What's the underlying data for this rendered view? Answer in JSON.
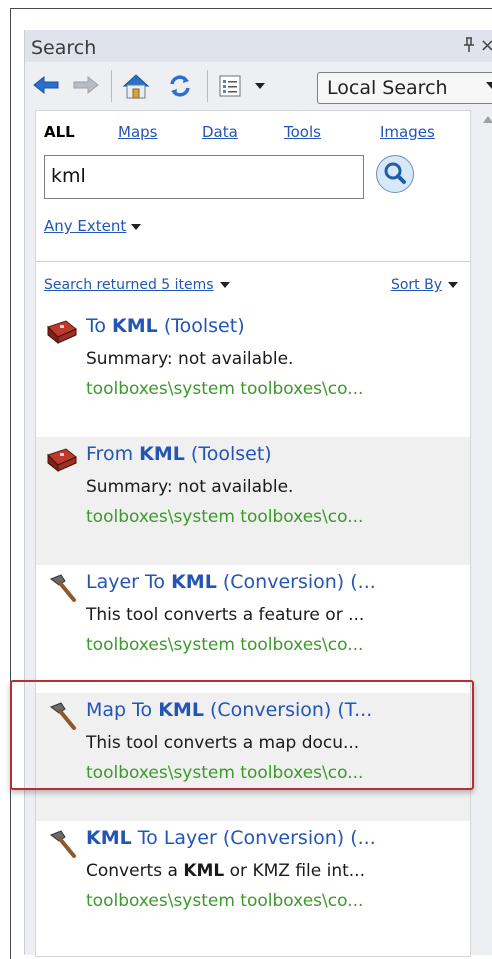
{
  "window": {
    "title": "Search",
    "pin_glyph": "ᵾ",
    "close_glyph": "×"
  },
  "toolbar": {
    "back_icon": "back-arrow-icon",
    "forward_icon": "forward-arrow-icon",
    "home_icon": "home-icon",
    "refresh_icon": "refresh-icon",
    "view_icon": "list-view-icon",
    "scope_value": "Local Search"
  },
  "tabs": [
    {
      "label": "ALL",
      "active": true
    },
    {
      "label": "Maps",
      "active": false
    },
    {
      "label": "Data",
      "active": false
    },
    {
      "label": "Tools",
      "active": false
    },
    {
      "label": "Images",
      "active": false
    }
  ],
  "search": {
    "value": "kml",
    "extent_label": "Any Extent"
  },
  "results_header": {
    "returned_label": "Search returned 5 items",
    "sort_label": "Sort By"
  },
  "results": [
    {
      "pre": "To ",
      "hl": "KML",
      "post": " (Toolset)",
      "summary_pre": "Summary: not available.",
      "summary_hl": "",
      "summary_post": "",
      "path": "toolboxes\\system toolboxes\\co...",
      "icon": "toolset-icon"
    },
    {
      "pre": "From ",
      "hl": "KML",
      "post": " (Toolset)",
      "summary_pre": "Summary: not available.",
      "summary_hl": "",
      "summary_post": "",
      "path": "toolboxes\\system toolboxes\\co...",
      "icon": "toolset-icon"
    },
    {
      "pre": "Layer To ",
      "hl": "KML",
      "post": " (Conversion) (...",
      "summary_pre": "This tool converts a feature or ...",
      "summary_hl": "",
      "summary_post": "",
      "path": "toolboxes\\system toolboxes\\co...",
      "icon": "hammer-icon"
    },
    {
      "pre": "Map To ",
      "hl": "KML",
      "post": " (Conversion) (T...",
      "summary_pre": "This tool converts a map docu...",
      "summary_hl": "",
      "summary_post": "",
      "path": "toolboxes\\system toolboxes\\co...",
      "icon": "hammer-icon"
    },
    {
      "pre": "",
      "hl": "KML",
      "post": " To Layer (Conversion) (...",
      "summary_pre": "Converts a ",
      "summary_hl": "KML",
      "summary_post": " or KMZ file int...",
      "path": "toolboxes\\system toolboxes\\co...",
      "icon": "hammer-icon"
    }
  ],
  "colors": {
    "link": "#2255b5",
    "path": "#3a9a2a",
    "highlight_border": "#b0303a"
  }
}
